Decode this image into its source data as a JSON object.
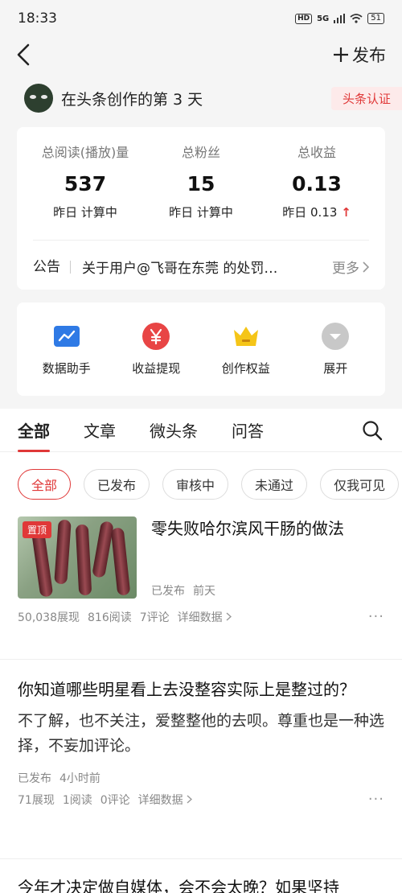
{
  "status": {
    "time": "18:33",
    "hd": "HD",
    "network": "5G",
    "battery": "51"
  },
  "header": {
    "publish_label": "发布"
  },
  "creator": {
    "text": "在头条创作的第 3 天",
    "cert_label": "头条认证"
  },
  "stats": [
    {
      "label": "总阅读(播放)量",
      "value": "537",
      "sub": "昨日 计算中"
    },
    {
      "label": "总粉丝",
      "value": "15",
      "sub": "昨日 计算中"
    },
    {
      "label": "总收益",
      "value": "0.13",
      "sub": "昨日 0.13"
    }
  ],
  "notice": {
    "label": "公告",
    "text": "关于用户@飞哥在东莞 的处罚…",
    "more": "更多"
  },
  "tools": [
    {
      "label": "数据助手",
      "icon": "chart-icon"
    },
    {
      "label": "收益提现",
      "icon": "yen-icon"
    },
    {
      "label": "创作权益",
      "icon": "crown-icon"
    },
    {
      "label": "展开",
      "icon": "expand-icon"
    }
  ],
  "tabs": [
    "全部",
    "文章",
    "微头条",
    "问答"
  ],
  "filters": [
    "全部",
    "已发布",
    "审核中",
    "未通过",
    "仅我可见"
  ],
  "articles": [
    {
      "pin": "置顶",
      "title": "零失败哈尔滨风干肠的做法",
      "status": "已发布",
      "time": "前天",
      "views": "50,038展现",
      "reads": "816阅读",
      "comments": "7评论",
      "detail": "详细数据"
    },
    {
      "title": "你知道哪些明星看上去没整容实际上是整过的？",
      "excerpt": "不了解，也不关注，爱整整他的去呗。尊重也是一种选择，不妄加评论。",
      "status": "已发布",
      "time": "4小时前",
      "views": "71展现",
      "reads": "1阅读",
      "comments": "0评论",
      "detail": "详细数据"
    },
    {
      "title": "今年才决定做自媒体，会不会太晚？如果坚持"
    }
  ],
  "colors": {
    "accent": "#e03838",
    "chart_icon": "#2f7ae5",
    "crown_icon": "#f5c518",
    "expand_icon": "#c8c8c8"
  }
}
